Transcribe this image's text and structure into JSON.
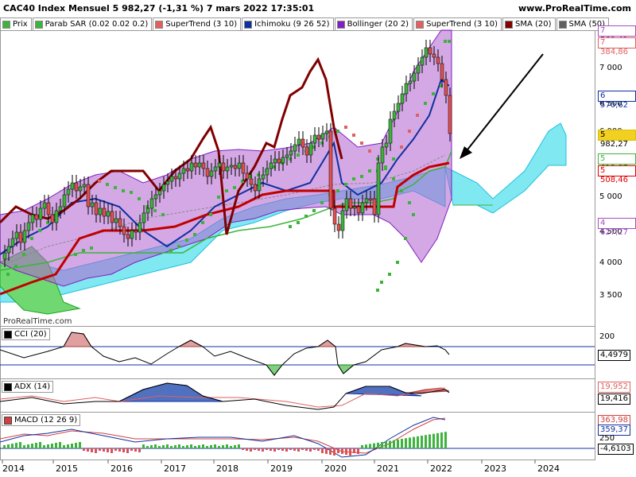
{
  "header": {
    "title": "CAC40 Index Mensuel 5 982,27 (-1,31 %) 7 mars 2022 17:35:01",
    "site": "www.ProRealTime.com"
  },
  "legend": [
    {
      "label": "Prix",
      "color": "#3cb43c"
    },
    {
      "label": "Parab SAR (0.02 0.02 0.2)",
      "color": "#3cb43c"
    },
    {
      "label": "SuperTrend (3 10)",
      "color": "#e06060"
    },
    {
      "label": "Ichimoku (9 26 52)",
      "color": "#1030a0"
    },
    {
      "label": "Bollinger (20 2)",
      "color": "#8020c0"
    },
    {
      "label": "SuperTrend (3 10)",
      "color": "#e06060"
    },
    {
      "label": "SMA (20)",
      "color": "#800000"
    },
    {
      "label": "SMA (50)",
      "color": "#606060"
    }
  ],
  "watermark": "ProRealTime.com",
  "price_axis": {
    "ticks": [
      "7 000",
      "6 500",
      "6 000",
      "5 500",
      "5 000",
      "4 500",
      "4 000",
      "3 500"
    ],
    "tags": [
      {
        "text": "7 569,41",
        "color": "#a050c0"
      },
      {
        "text": "7 384,86",
        "color": "#e06060"
      },
      {
        "text": "6 570,62",
        "color": "#1030a0"
      },
      {
        "text": "5 982,27",
        "color": "#e0c000"
      },
      {
        "text": "5 613,87",
        "color": "#3cb43c"
      },
      {
        "text": "5 508,46",
        "color": "#e00000"
      },
      {
        "text": "4 627,27",
        "color": "#a050c0"
      }
    ]
  },
  "time_axis": {
    "labels": [
      "2014",
      "2015",
      "2016",
      "2017",
      "2018",
      "2019",
      "2020",
      "2021",
      "2022",
      "2023",
      "2024"
    ]
  },
  "panels": {
    "cci": {
      "label": "CCI (20)",
      "axis": "200",
      "value": "4,4979",
      "color": "#000000"
    },
    "adx": {
      "label": "ADX (14)",
      "value1": "19,952",
      "value2": "19,416",
      "color": "#000000"
    },
    "macd": {
      "label": "MACD (12 26 9)",
      "value1": "363,98",
      "value2": "359,37",
      "value3": "-4,6103",
      "axis": "250",
      "color": "#d04040"
    }
  }
}
